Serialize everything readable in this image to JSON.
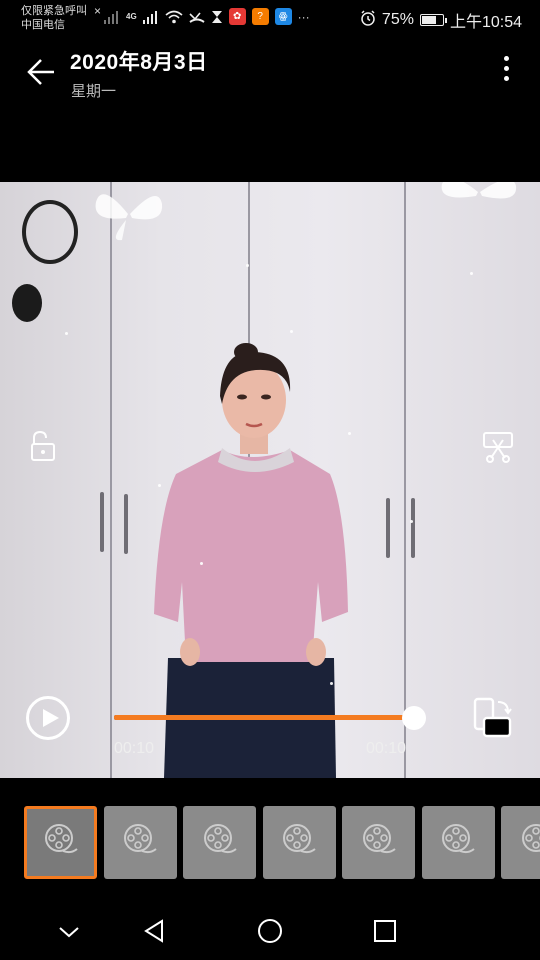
{
  "status_bar": {
    "emergency_text": "仅限紧急呼叫",
    "carrier": "中国电信",
    "close_symbol": "×",
    "network": "4G",
    "more_symbol": "···",
    "battery_percent": "75%",
    "battery_level": 0.75,
    "time": "上午10:54"
  },
  "header": {
    "title": "2020年8月3日",
    "subtitle": "星期一"
  },
  "player": {
    "current_time": "00:10",
    "total_time": "00:10",
    "progress": 1.0
  },
  "thumbnails": {
    "count": 7,
    "selected_index": 0
  },
  "colors": {
    "accent": "#f47b20",
    "background": "#000000"
  },
  "icons": [
    "back-arrow-icon",
    "more-vertical-icon",
    "unlock-icon",
    "scissors-icon",
    "play-icon",
    "rotate-icon",
    "video-reel-icon",
    "nav-collapse-icon",
    "nav-back-icon",
    "nav-home-icon",
    "nav-recents-icon"
  ]
}
